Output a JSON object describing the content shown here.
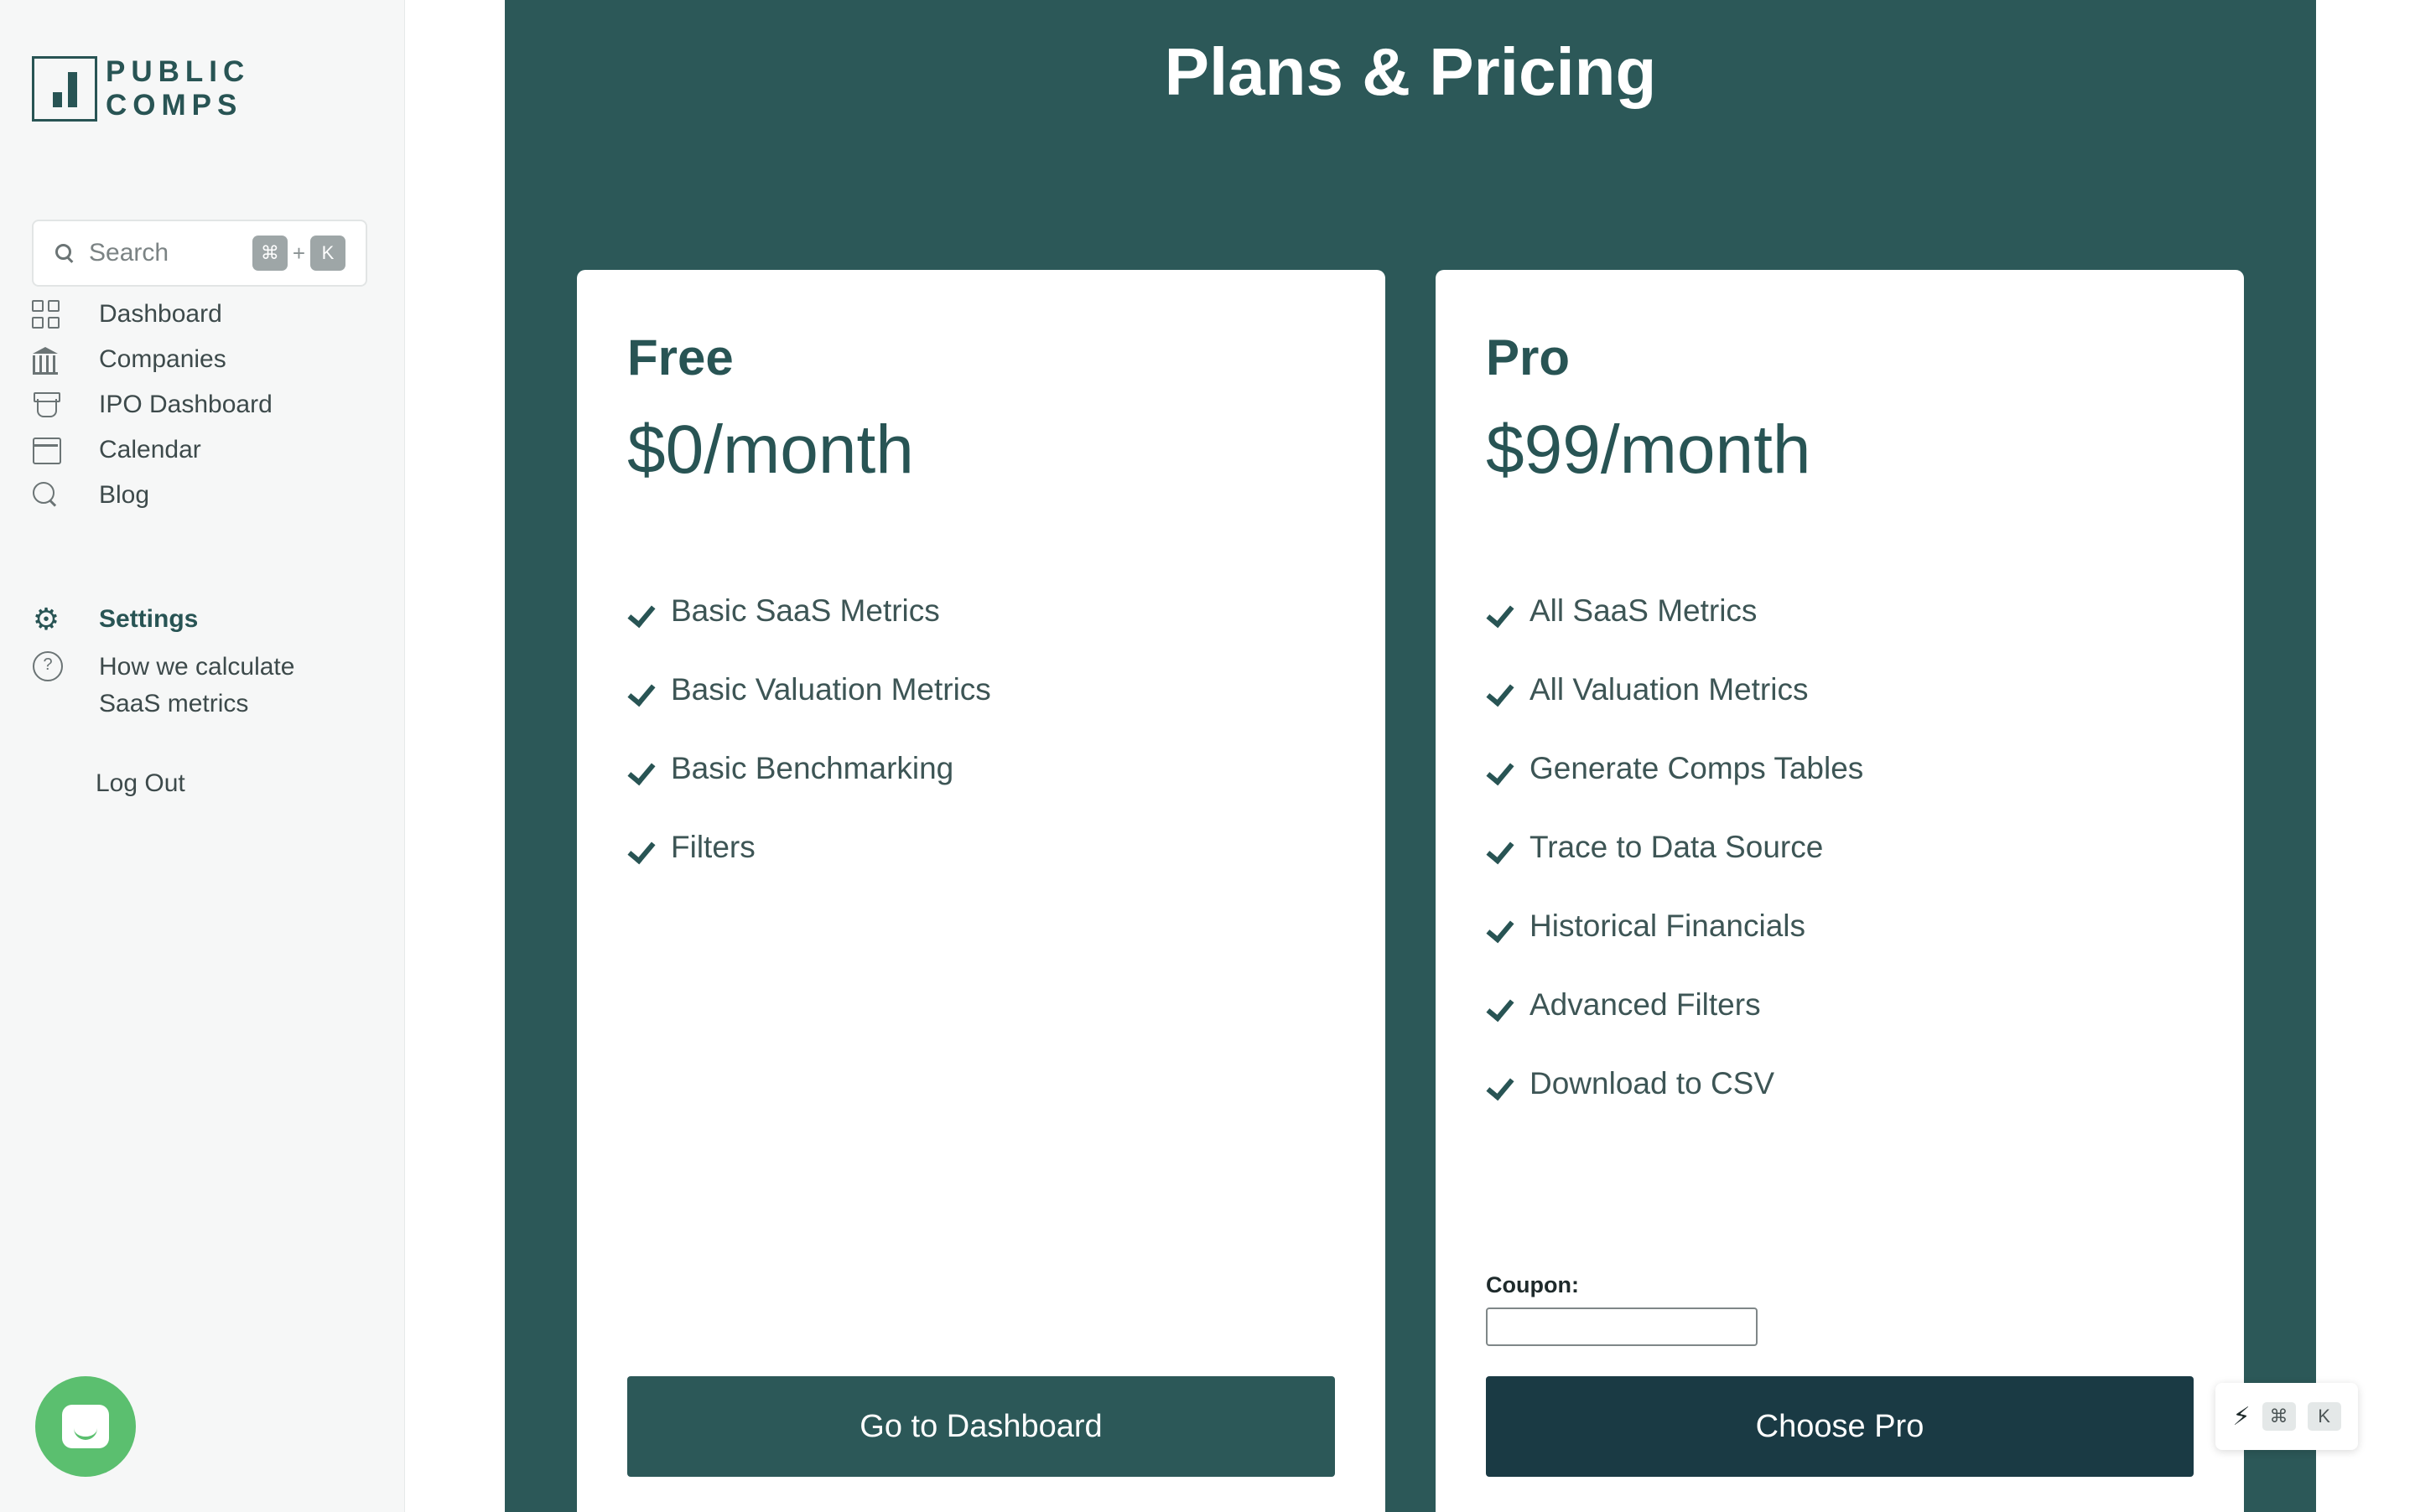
{
  "brand": {
    "line1": "PUBLIC",
    "line2": "COMPS",
    "color": "#285454"
  },
  "search": {
    "placeholder": "Search",
    "shortcut_mod": "⌘",
    "shortcut_plus": "+",
    "shortcut_key": "K"
  },
  "sidebar": {
    "items": [
      {
        "label": "Dashboard",
        "icon": "dashboard-grid-icon"
      },
      {
        "label": "Companies",
        "icon": "bank-icon"
      },
      {
        "label": "IPO Dashboard",
        "icon": "ipo-icon"
      },
      {
        "label": "Calendar",
        "icon": "calendar-icon"
      },
      {
        "label": "Blog",
        "icon": "blog-search-icon"
      }
    ],
    "settings": {
      "label": "Settings",
      "icon": "gear-icon"
    },
    "help": {
      "label_line1": "How we calculate",
      "label_line2": "SaaS metrics",
      "icon": "help-circle-icon"
    },
    "logout": "Log Out"
  },
  "page": {
    "title": "Plans & Pricing"
  },
  "plans": {
    "free": {
      "name": "Free",
      "price": "$0/month",
      "features": [
        "Basic SaaS Metrics",
        "Basic Valuation Metrics",
        "Basic Benchmarking",
        "Filters"
      ],
      "button": "Go to Dashboard"
    },
    "pro": {
      "name": "Pro",
      "price": "$99/month",
      "features": [
        "All SaaS Metrics",
        "All Valuation Metrics",
        "Generate Comps Tables",
        "Trace to Data Source",
        "Historical Financials",
        "Advanced Filters",
        "Download to CSV"
      ],
      "coupon_label": "Coupon:",
      "coupon_value": "",
      "button": "Choose Pro"
    }
  },
  "shortcut_popup": {
    "icon": "bolt-icon",
    "mod": "⌘",
    "key": "K"
  },
  "colors": {
    "panel": "#2c5858",
    "accent": "#285454",
    "pro_button": "#1a3a44",
    "chat": "#5bbf6f"
  }
}
